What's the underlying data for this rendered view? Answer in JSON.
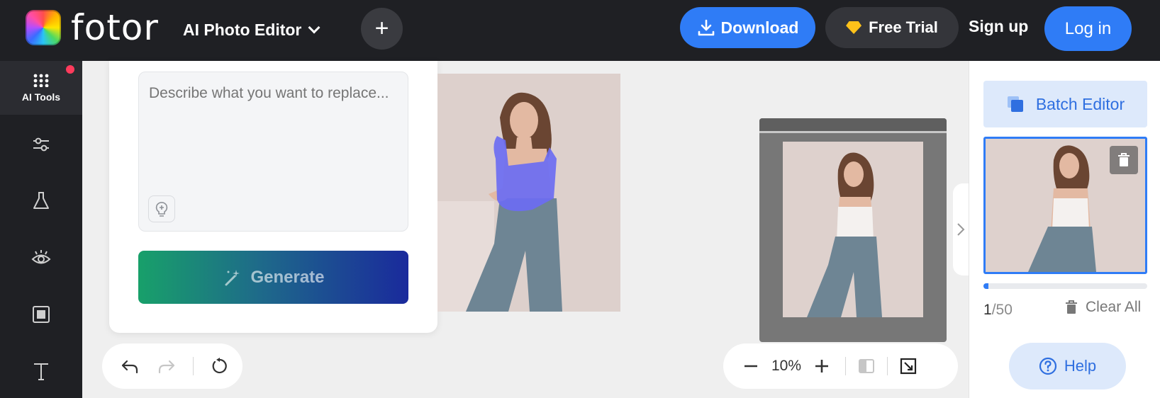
{
  "header": {
    "brand": "fotor",
    "app_switcher_label": "AI Photo Editor",
    "new_button_icon": "plus-icon",
    "download_label": "Download",
    "free_trial_label": "Free Trial",
    "signup_label": "Sign up",
    "login_label": "Log in"
  },
  "sidebar": {
    "items": [
      {
        "label": "AI Tools",
        "icon": "grid-dots-icon",
        "active": true,
        "badge": true
      },
      {
        "label": "",
        "icon": "sliders-icon"
      },
      {
        "label": "",
        "icon": "flask-icon"
      },
      {
        "label": "",
        "icon": "eye-icon"
      },
      {
        "label": "",
        "icon": "square-frame-icon"
      },
      {
        "label": "",
        "icon": "text-t-icon"
      }
    ]
  },
  "replace_panel": {
    "prompt_placeholder": "Describe what you want to replace...",
    "prompt_value": "",
    "generate_label": "Generate"
  },
  "canvas": {
    "zoom": "10%"
  },
  "right_panel": {
    "batch_editor_label": "Batch Editor",
    "image_count": "1",
    "image_limit": "/50",
    "clear_all_label": "Clear All",
    "help_label": "Help",
    "upload_progress": 0.03
  },
  "colors": {
    "accent": "#2f7cf6",
    "topbar": "#1f2024",
    "mask": "#6b6cf2",
    "badge": "#ff3b5c"
  }
}
